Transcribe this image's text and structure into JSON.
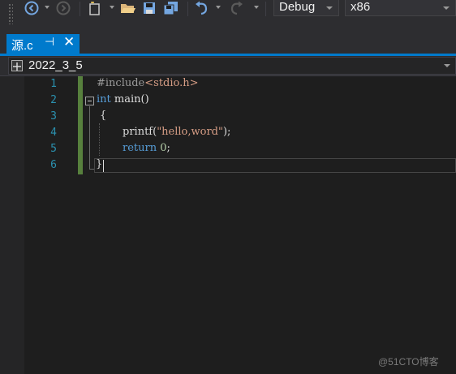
{
  "toolbar": {
    "config": "Debug",
    "platform": "x86"
  },
  "tab": {
    "title": "源.c",
    "pin_glyph": "⊣",
    "close_glyph": "✕"
  },
  "navbar": {
    "scope": "2022_3_5"
  },
  "editor": {
    "line_numbers": [
      "1",
      "2",
      "3",
      "4",
      "5",
      "6"
    ],
    "lines": {
      "l1_directive": "#include",
      "l1_header": "<stdio.h>",
      "l2_kw": "int",
      "l2_rest": " main()",
      "l3": "{",
      "l4_fn": "printf",
      "l4_open": "(",
      "l4_str": "\"hello,word\"",
      "l4_close": ");",
      "l5_kw": "return",
      "l5_sp": " ",
      "l5_num": "0",
      "l5_end": ";",
      "l6": "}"
    }
  },
  "watermark": "@51CTO博客"
}
